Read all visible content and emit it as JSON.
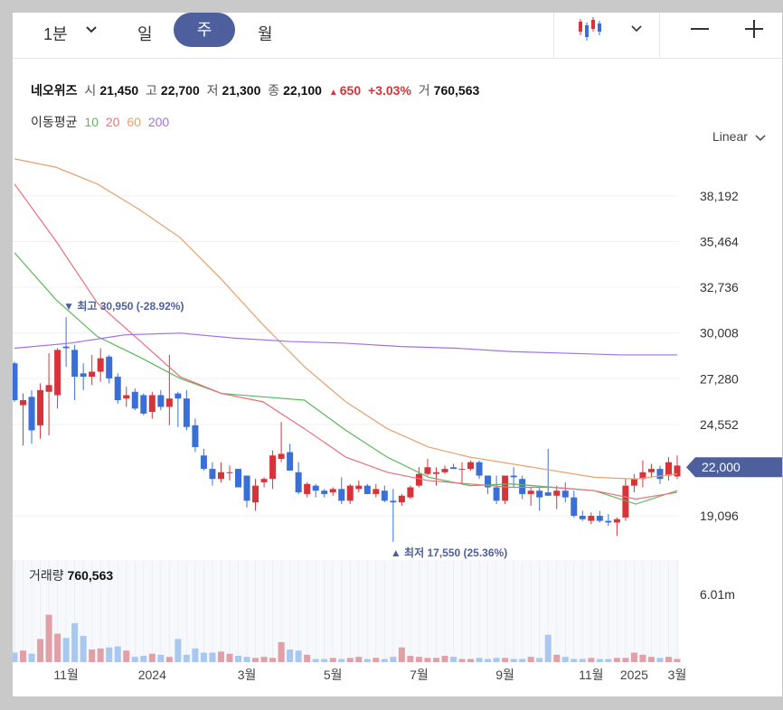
{
  "toolbar": {
    "period_label": "1분",
    "tabs": [
      {
        "label": "일",
        "selected": false
      },
      {
        "label": "주",
        "selected": true
      },
      {
        "label": "월",
        "selected": false
      }
    ],
    "chart_type_icon": "candlestick-icon",
    "zoom_out_icon": "minus-icon",
    "zoom_in_icon": "plus-icon"
  },
  "info": {
    "name": "네오위즈",
    "open_label": "시",
    "open": "21,450",
    "high_label": "고",
    "high": "22,700",
    "low_label": "저",
    "low": "21,300",
    "close_label": "종",
    "close": "22,100",
    "change": "650",
    "change_pct": "+3.03%",
    "volume_label": "거",
    "volume": "760,563"
  },
  "moving_average": {
    "label": "이동평균",
    "periods": [
      "10",
      "20",
      "60",
      "200"
    ]
  },
  "scale_label": "Linear",
  "colors": {
    "up": "#d6343a",
    "down": "#3a6fd8",
    "ma10": "#5cb85c",
    "ma20": "#e8707a",
    "ma60": "#e8a070",
    "ma200": "#a070e8",
    "price_tag": "#4d5f9c",
    "vol_up": "#e0a0a8",
    "vol_down": "#a8c8f0"
  },
  "chart_data": {
    "type": "candlestick",
    "y_ticks": [
      "38,192",
      "35,464",
      "32,736",
      "30,008",
      "27,280",
      "24,552",
      "19,096"
    ],
    "ylim": [
      17000,
      40500
    ],
    "current_price_label": "22,000",
    "current_price": 22000,
    "x_ticks": [
      "11월",
      "2024",
      "3월",
      "5월",
      "7월",
      "9월",
      "11월",
      "2025",
      "3월"
    ],
    "annotations": {
      "high": "▼ 최고 30,950 (-28.92%)",
      "low": "▲ 최저 17,550 (25.36%)"
    },
    "ohlc": [
      [
        28200,
        28300,
        25900,
        26000
      ],
      [
        25700,
        26400,
        23300,
        26000
      ],
      [
        26200,
        26600,
        23400,
        24200
      ],
      [
        24500,
        27000,
        23700,
        26600
      ],
      [
        26500,
        28800,
        23900,
        26900
      ],
      [
        26300,
        29100,
        25500,
        29000
      ],
      [
        29200,
        30950,
        28000,
        29100
      ],
      [
        29000,
        29300,
        26000,
        27400
      ],
      [
        27600,
        28200,
        26600,
        27400
      ],
      [
        27400,
        28700,
        26900,
        27700
      ],
      [
        27700,
        29100,
        27100,
        28500
      ],
      [
        28600,
        28700,
        27000,
        27300
      ],
      [
        27400,
        27600,
        25800,
        26000
      ],
      [
        26100,
        26800,
        25600,
        26300
      ],
      [
        26500,
        26700,
        25400,
        25500
      ],
      [
        26300,
        26400,
        25100,
        25200
      ],
      [
        25300,
        26500,
        24900,
        26300
      ],
      [
        26300,
        26600,
        25400,
        25600
      ],
      [
        25600,
        28700,
        24500,
        26100
      ],
      [
        26400,
        26500,
        24400,
        26100
      ],
      [
        26100,
        26600,
        24200,
        24400
      ],
      [
        24500,
        24900,
        22900,
        23200
      ],
      [
        22700,
        23100,
        21800,
        21900
      ],
      [
        21900,
        22300,
        20900,
        21300
      ],
      [
        21300,
        22300,
        21100,
        21700
      ],
      [
        21700,
        22100,
        21200,
        21700
      ],
      [
        21900,
        21900,
        20800,
        20800
      ],
      [
        21500,
        21500,
        19600,
        20000
      ],
      [
        19900,
        21300,
        19400,
        20900
      ],
      [
        21100,
        21400,
        20800,
        21300
      ],
      [
        21300,
        23000,
        20700,
        22700
      ],
      [
        22500,
        24700,
        22300,
        22800
      ],
      [
        22900,
        23400,
        21800,
        21800
      ],
      [
        21700,
        22300,
        20400,
        20500
      ],
      [
        20400,
        21100,
        20200,
        21000
      ],
      [
        20900,
        21000,
        20200,
        20600
      ],
      [
        20600,
        20700,
        20200,
        20400
      ],
      [
        20500,
        20800,
        20300,
        20700
      ],
      [
        20700,
        21400,
        19800,
        20000
      ],
      [
        20000,
        21000,
        19800,
        20900
      ],
      [
        20700,
        21200,
        20500,
        20900
      ],
      [
        20900,
        21000,
        20400,
        20400
      ],
      [
        20400,
        21000,
        20200,
        20700
      ],
      [
        20600,
        20900,
        19900,
        20000
      ],
      [
        20000,
        20700,
        17550,
        19900
      ],
      [
        19900,
        20400,
        19700,
        20300
      ],
      [
        20200,
        20900,
        20100,
        20800
      ],
      [
        20900,
        22000,
        20800,
        21600
      ],
      [
        21600,
        22500,
        21500,
        22000
      ],
      [
        21600,
        22000,
        20900,
        21700
      ],
      [
        21700,
        22100,
        21600,
        21900
      ],
      [
        22000,
        22200,
        21900,
        21900
      ],
      [
        21900,
        22300,
        21000,
        21900
      ],
      [
        21900,
        22400,
        21800,
        22300
      ],
      [
        22300,
        22400,
        21300,
        21500
      ],
      [
        21500,
        21500,
        20400,
        20800
      ],
      [
        20800,
        21500,
        19800,
        20000
      ],
      [
        20000,
        21400,
        19800,
        21500
      ],
      [
        21500,
        22000,
        20800,
        21400
      ],
      [
        21300,
        21500,
        20100,
        20400
      ],
      [
        20400,
        20800,
        19700,
        20600
      ],
      [
        20600,
        20800,
        19400,
        20200
      ],
      [
        20500,
        23100,
        20300,
        20300
      ],
      [
        20300,
        20900,
        19500,
        20600
      ],
      [
        20600,
        21100,
        19900,
        20200
      ],
      [
        20200,
        20600,
        19000,
        19100
      ],
      [
        19100,
        19400,
        18800,
        18900
      ],
      [
        18800,
        19300,
        18600,
        19100
      ],
      [
        19100,
        19400,
        18700,
        18800
      ],
      [
        18800,
        19200,
        18500,
        18700
      ],
      [
        18700,
        19000,
        17900,
        18900
      ],
      [
        19000,
        21300,
        18800,
        20900
      ],
      [
        20900,
        21600,
        20500,
        21300
      ],
      [
        21300,
        22400,
        20800,
        21700
      ],
      [
        21700,
        22200,
        21400,
        21900
      ],
      [
        21900,
        22100,
        21000,
        21300
      ],
      [
        21500,
        22600,
        21200,
        22300
      ],
      [
        21450,
        22700,
        21300,
        22100
      ]
    ],
    "ma10": [
      34800,
      32000,
      29800,
      28600,
      27300,
      26400,
      26200,
      26000,
      24200,
      22600,
      21400,
      20900,
      21000,
      20800,
      20600,
      19800,
      20600
    ],
    "ma20": [
      38900,
      35500,
      31800,
      29600,
      27400,
      26400,
      25900,
      24300,
      22600,
      21700,
      21200,
      21000,
      20800,
      20800,
      20600,
      20100,
      20500
    ],
    "ma60": [
      40400,
      39900,
      38900,
      37400,
      35700,
      33200,
      30500,
      28000,
      25900,
      24300,
      23200,
      22600,
      22200,
      21800,
      21400,
      21300,
      21600
    ],
    "ma200": [
      29100,
      29400,
      29900,
      30000,
      29700,
      29500,
      29400,
      29200,
      29100,
      28900,
      28800,
      28700,
      28700
    ],
    "volume_title": "거래량",
    "volume_value": "760,563",
    "volume_tick": "6.01m",
    "volume": [
      0.9,
      1.1,
      0.8,
      2.2,
      4.5,
      2.7,
      2.3,
      3.7,
      2.5,
      1.2,
      1.3,
      1.4,
      1.5,
      1.1,
      0.5,
      0.6,
      0.8,
      0.7,
      0.5,
      2.2,
      0.7,
      1.3,
      0.9,
      0.9,
      1.0,
      0.8,
      0.6,
      0.5,
      0.4,
      0.5,
      0.4,
      1.9,
      1.2,
      1.1,
      0.7,
      0.3,
      0.3,
      0.4,
      0.3,
      0.4,
      0.5,
      0.3,
      0.4,
      0.3,
      0.5,
      1.4,
      0.6,
      0.5,
      0.4,
      0.4,
      0.6,
      0.5,
      0.3,
      0.3,
      0.4,
      0.3,
      0.4,
      0.4,
      0.3,
      0.3,
      0.5,
      0.4,
      2.6,
      0.7,
      0.5,
      0.3,
      0.3,
      0.4,
      0.3,
      0.3,
      0.4,
      0.4,
      0.9,
      0.7,
      0.5,
      0.4,
      0.5,
      0.3
    ]
  }
}
